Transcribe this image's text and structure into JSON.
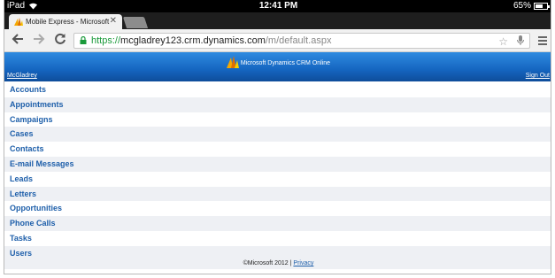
{
  "statusbar": {
    "device": "iPad",
    "time": "12:41 PM",
    "battery": "65%",
    "battery_level": 0.65
  },
  "browser": {
    "tab_title": "Mobile Express - Microsoft",
    "close_glyph": "✕",
    "url_scheme": "https://",
    "url_host": "mcgladrey123.crm.dynamics.com",
    "url_path": "/m/default.aspx"
  },
  "crm": {
    "brand": "Microsoft Dynamics CRM Online",
    "user": "McGladrey",
    "sign_out": "Sign Out",
    "entities": [
      "Accounts",
      "Appointments",
      "Campaigns",
      "Cases",
      "Contacts",
      "E-mail Messages",
      "Leads",
      "Letters",
      "Opportunities",
      "Phone Calls",
      "Tasks",
      "Users"
    ],
    "footer_copyright": "©Microsoft 2012 |",
    "footer_privacy": "Privacy"
  },
  "colors": {
    "header_blue": "#1565c0",
    "link_blue": "#1e5faa",
    "secure_green": "#1a9a3a"
  }
}
